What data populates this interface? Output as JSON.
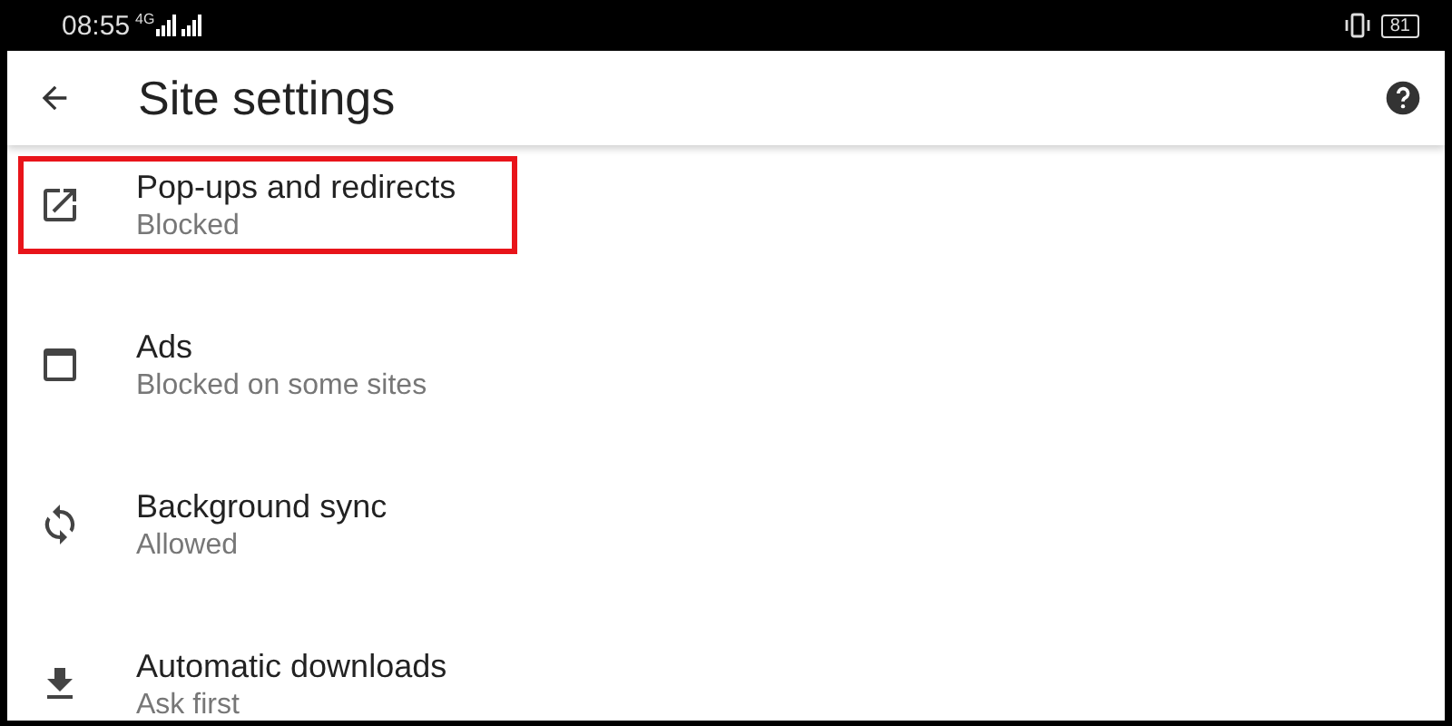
{
  "status_bar": {
    "time": "08:55",
    "network": "4G",
    "battery": "81"
  },
  "app_bar": {
    "title": "Site settings"
  },
  "items": [
    {
      "kind": "popup",
      "title": "Pop-ups and redirects",
      "summary": "Blocked",
      "highlighted": true
    },
    {
      "kind": "ads",
      "title": "Ads",
      "summary": "Blocked on some sites",
      "highlighted": false
    },
    {
      "kind": "sync",
      "title": "Background sync",
      "summary": "Allowed",
      "highlighted": false
    },
    {
      "kind": "download",
      "title": "Automatic downloads",
      "summary": "Ask first",
      "highlighted": false
    }
  ]
}
